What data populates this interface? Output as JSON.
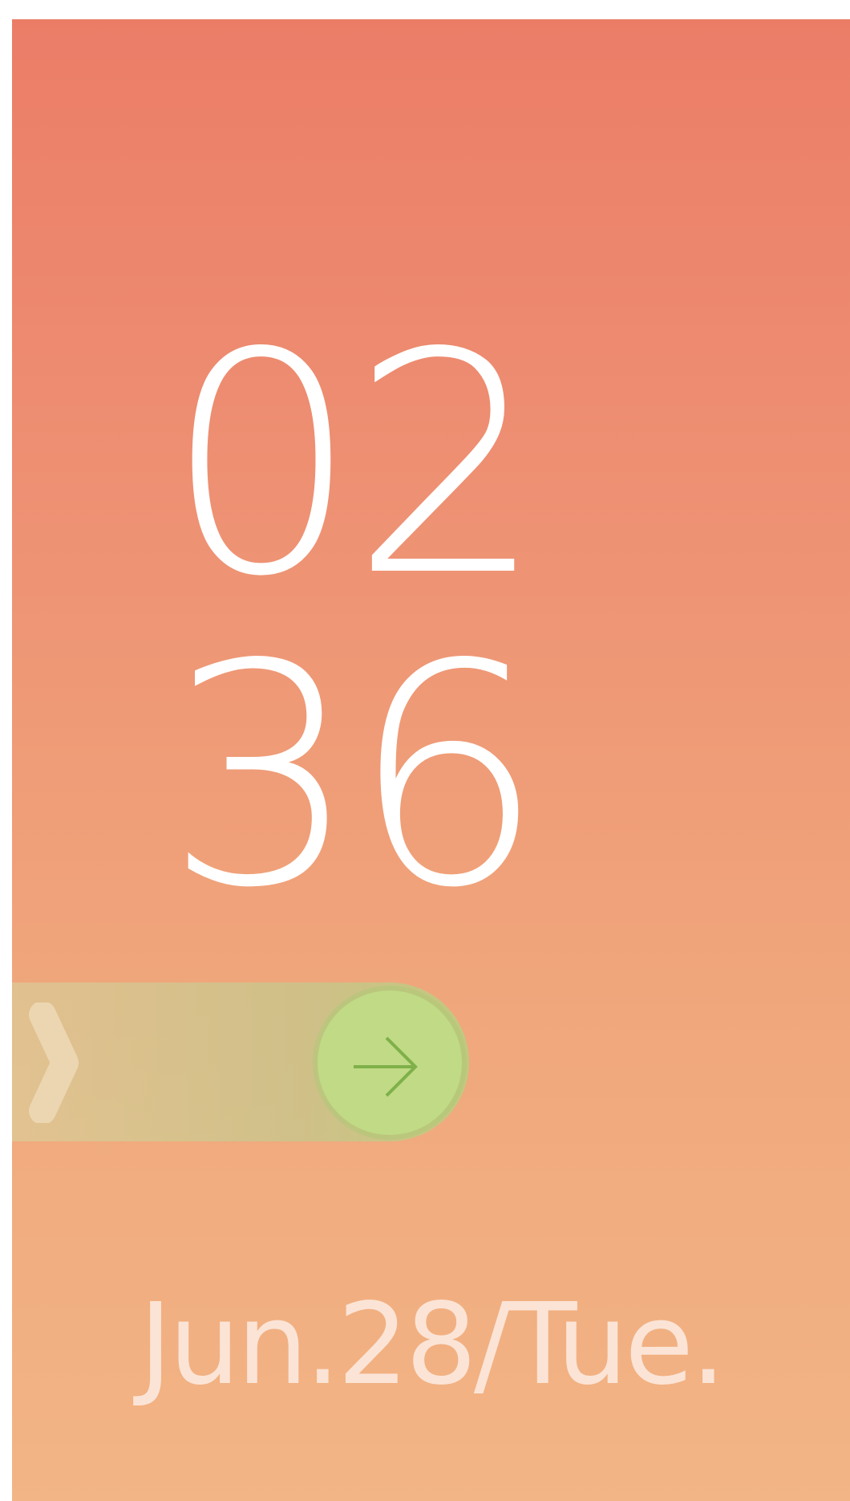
{
  "clock": {
    "hours": "02",
    "minutes": "36"
  },
  "unlock_slider": {
    "chevron_icon": "chevron-right-icon",
    "knob_icon": "arrow-right-icon",
    "colors": {
      "knob": "#c0da86",
      "arrow": "#7fb04a"
    }
  },
  "date": {
    "text": "Jun.28/Tue."
  },
  "colors": {
    "background_top": "#eb7d67",
    "background_bottom": "#f2b585",
    "time_text": "#ffffff",
    "date_text": "#fbe4d6"
  }
}
